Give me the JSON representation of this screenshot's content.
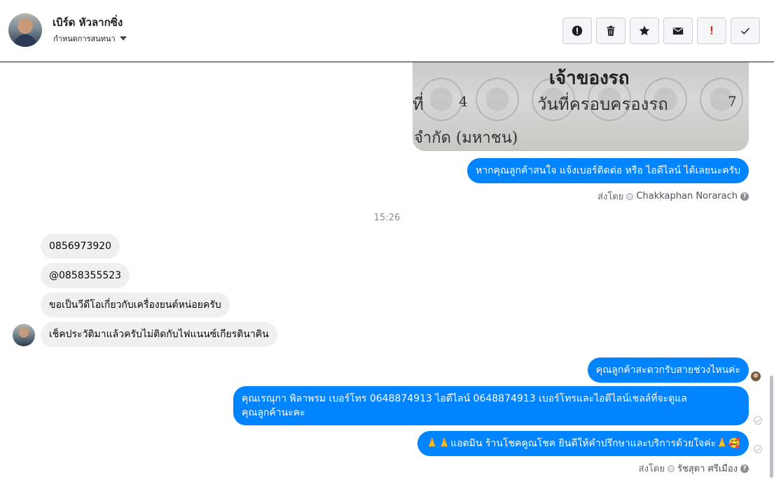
{
  "header": {
    "contact_name": "เบิร์ด หัวลากซิ่ง",
    "contact_sub": "กำหนดการสนทนา",
    "toolbar": [
      {
        "name": "report-icon"
      },
      {
        "name": "delete-icon"
      },
      {
        "name": "star-icon"
      },
      {
        "name": "mail-icon"
      },
      {
        "name": "mark-important-icon",
        "text": "!"
      },
      {
        "name": "done-check-icon"
      }
    ]
  },
  "image_message": {
    "title": "เจ้าของรถ",
    "row1_left": "ที่",
    "row1_num": "4",
    "row1_mid": "วันที่ครอบครองรถ",
    "row1_right": "7",
    "row2": "จำกัด    (มหาชน)"
  },
  "messages": {
    "out1": "หากคุณลูกค้าสนใจ แจ้งเบอร์ติดต่อ หรือ ไอดีไลน์ ได้เลยนะครับ",
    "sent_by1_prefix": "ส่งโดย",
    "sent_by1_name": "Chakkaphan Norarach",
    "timestamp": "15:26",
    "in1": "0856973920",
    "in2": "@0858355523",
    "in3": "ขอเป็นวีดีโอเกี่ยวกับเครื่องยนต์หน่อยครับ",
    "in4": "เช็คประวัติมาแล้วครับไม่ติดกับไฟแนนซ์เกียรตินาคิน",
    "out2": "คุณลูกค้าสะดวกรับสายช่วงไหนค่ะ",
    "out3_line1": "คุณเรณุกา พิลาพรม        เบอร์โทร 0648874913  ไอดีไลน์ 0648874913   เบอร์โทรและไอดีไลน์เชลล์ที่จะดูแล",
    "out3_line2": "คุณลูกค้านะคะ",
    "out4": "🙏🙏แอดมิน ร้านโชคคูณโชค ยินดีให้คำปรึกษาและบริการด้วยใจค่ะ🙏🥰",
    "sent_by2_prefix": "ส่งโดย",
    "sent_by2_name": "รัชสุดา ศรีเมือง"
  },
  "colors": {
    "outgoing": "#0084ff",
    "incoming": "#f0f0f0",
    "accent_red": "#e02020"
  }
}
